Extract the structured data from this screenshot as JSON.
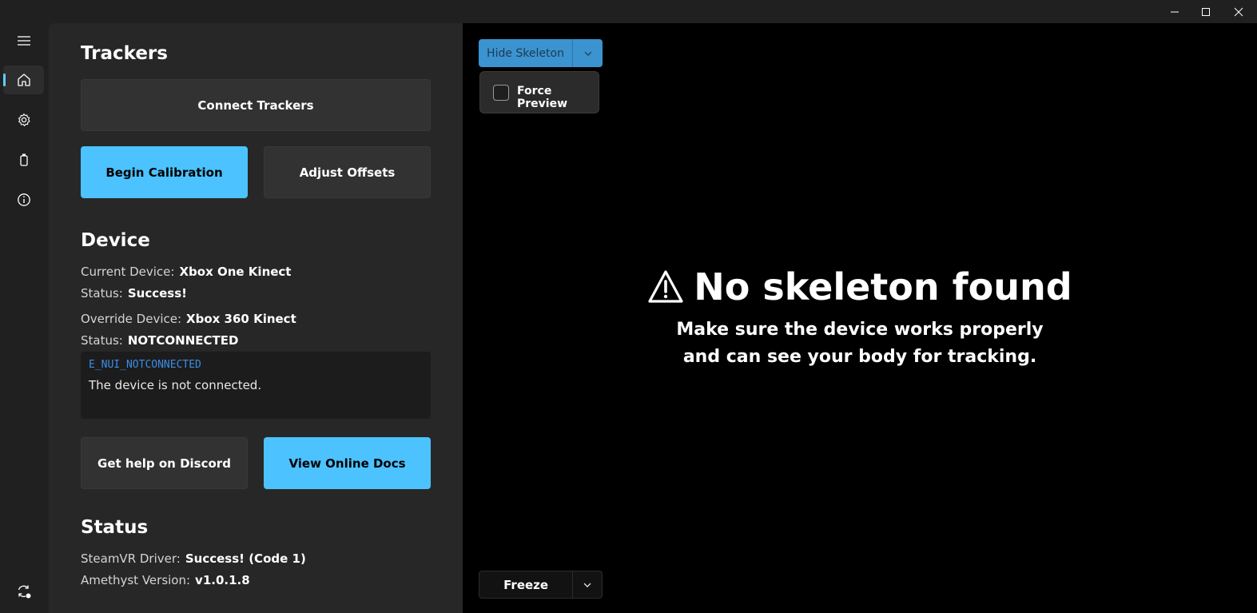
{
  "window": {
    "controls": [
      "minimize-icon",
      "maximize-icon",
      "close-icon"
    ]
  },
  "nav": {
    "items": [
      {
        "icon": "hamburger-menu-icon"
      },
      {
        "icon": "home-icon",
        "active": true
      },
      {
        "icon": "gear-icon"
      },
      {
        "icon": "battery-icon"
      },
      {
        "icon": "info-icon"
      }
    ],
    "bottom_icon": "sync-icon"
  },
  "trackers": {
    "title": "Trackers",
    "connect_label": "Connect Trackers",
    "calibration_label": "Begin Calibration",
    "offsets_label": "Adjust Offsets"
  },
  "device": {
    "title": "Device",
    "current_label": "Current Device:",
    "current_value": "Xbox One Kinect",
    "status1_label": "Status:",
    "status1_value": "Success!",
    "override_label": "Override Device:",
    "override_value": "Xbox 360 Kinect",
    "status2_label": "Status:",
    "status2_value": "NOTCONNECTED",
    "error_code": "E_NUI_NOTCONNECTED",
    "error_message": "The device is not connected.",
    "discord_label": "Get help on Discord",
    "docs_label": "View Online Docs"
  },
  "status": {
    "title": "Status",
    "driver_label": "SteamVR Driver:",
    "driver_value": "Success! (Code 1)",
    "version_label": "Amethyst Version:",
    "version_value": "v1.0.1.8"
  },
  "preview": {
    "skeleton_button": "Hide Skeleton",
    "force_preview_label": "Force Preview",
    "force_preview_checked": false,
    "no_skeleton_title": "No skeleton found",
    "no_skeleton_line1": "Make sure the device works properly",
    "no_skeleton_line2": "and can see your body for tracking.",
    "freeze_button": "Freeze"
  },
  "colors": {
    "accent": "#4cc2ff",
    "error_code": "#3b8ee8",
    "panel": "#272727",
    "background": "#202020"
  }
}
